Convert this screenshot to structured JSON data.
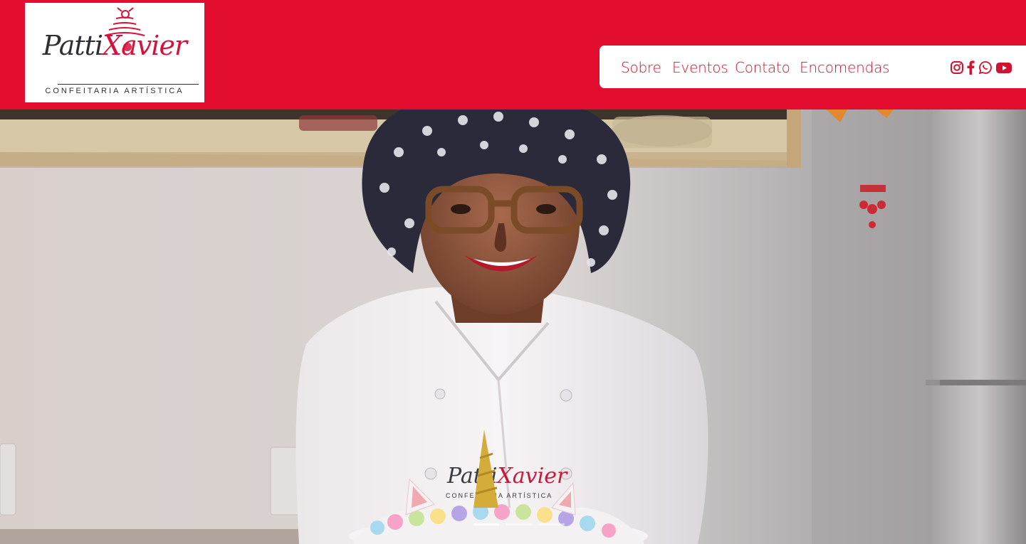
{
  "brand": {
    "logo_name_part1": "Patti",
    "logo_name_part2": "Xavier",
    "logo_tagline": "CONFEITARIA ARTÍSTICA",
    "color_primary": "#e30d2f",
    "color_text": "#2f2f33"
  },
  "nav": {
    "links": [
      {
        "label": "Sobre"
      },
      {
        "label": "Eventos"
      },
      {
        "label": "Contato"
      },
      {
        "label": "Encomendas"
      }
    ],
    "social": [
      {
        "icon": "instagram-icon"
      },
      {
        "icon": "facebook-icon"
      },
      {
        "icon": "whatsapp-icon"
      },
      {
        "icon": "youtube-icon"
      }
    ]
  },
  "hero": {
    "image": "chef-portrait-photo",
    "apron_logo_part1": "Patti",
    "apron_logo_part2": "Xavier",
    "apron_tagline": "CONFEITARIA ARTÍSTICA",
    "carousel_slides": 3,
    "active_slide": 1
  }
}
